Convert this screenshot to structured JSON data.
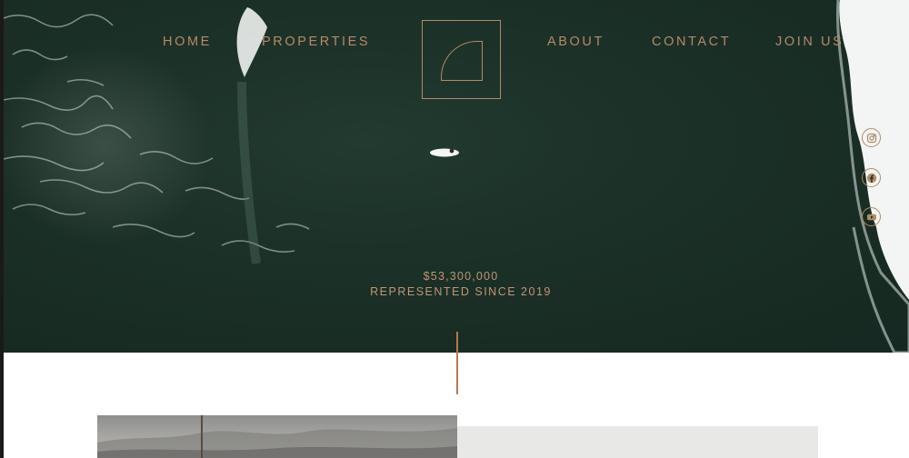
{
  "nav": {
    "left": [
      "HOME",
      "PROPERTIES"
    ],
    "right": [
      "ABOUT",
      "CONTACT",
      "JOIN US"
    ]
  },
  "social": [
    "instagram-icon",
    "facebook-icon",
    "youtube-icon"
  ],
  "hero": {
    "amount": "$53,300,000",
    "caption": "REPRESENTED SINCE 2019"
  },
  "colors": {
    "accent": "#b48a66",
    "ocean": "#1b3026",
    "panel": "#e8e8e6"
  }
}
